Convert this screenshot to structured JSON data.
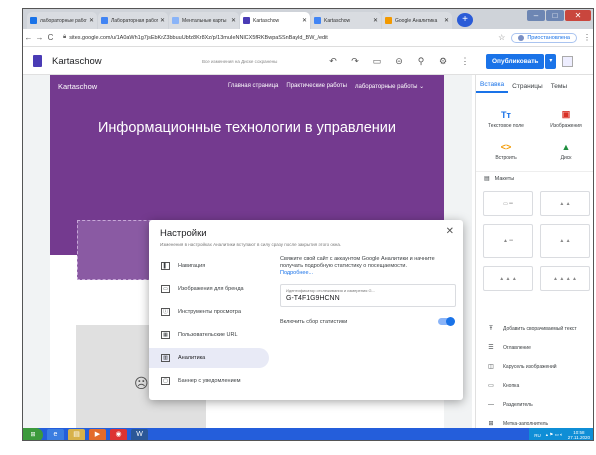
{
  "browser": {
    "tabs": [
      {
        "label": "лабораторные работ",
        "favicon_color": "#1a73e8",
        "active": false
      },
      {
        "label": "Лабораторная работ",
        "favicon_color": "#4285f4",
        "active": false
      },
      {
        "label": "Ментальные карты",
        "favicon_color": "#8ab4f8",
        "active": false
      },
      {
        "label": "Kartaschow",
        "favicon_color": "#4a3bb5",
        "active": true
      },
      {
        "label": "Kartaschow",
        "favicon_color": "#4285f4",
        "active": false
      },
      {
        "label": "Google Аналитика",
        "favicon_color": "#f29900",
        "active": false
      }
    ],
    "url": "sites.google.com/u/1A0aWh1g7jsEbKrZ3bbuuUbfz8Kr8Xz/p/13muIeNNlCX5fRKBwpaSSnBayld_BW_/edit",
    "profile_label": "Приостановлена"
  },
  "site_header": {
    "name": "Kartaschow",
    "saved_message": "Все изменения на Диске сохранены",
    "publish_label": "Опубликовать"
  },
  "site_page": {
    "name": "Kartaschow",
    "nav": [
      "Главная страница",
      "Практические работы",
      "лабораторные работы ⌄"
    ],
    "hero_title": "Информационные технологии в управлении"
  },
  "settings_dialog": {
    "title": "Настройки",
    "subtitle": "Изменения в настройках Аналитики вступают в силу сразу после закрытия этого окна.",
    "menu": [
      {
        "label": "Навигация",
        "icon": "navigation-icon",
        "active": false
      },
      {
        "label": "Изображения для бренда",
        "icon": "image-icon",
        "active": false
      },
      {
        "label": "Инструменты просмотра",
        "icon": "info-icon",
        "active": false
      },
      {
        "label": "Пользовательские URL",
        "icon": "url-icon",
        "active": false
      },
      {
        "label": "Аналитика",
        "icon": "analytics-icon",
        "active": true
      },
      {
        "label": "Баннер с уведомлением",
        "icon": "banner-icon",
        "active": false
      }
    ],
    "description": "Свяжите свой сайт с аккаунтом Google Аналитики и начните получать подробную статистику о посещаемости.",
    "more_link": "Подробнее...",
    "tracking_label": "Идентификатор отслеживания и измерения G...",
    "tracking_value": "G-T4F1G9HCNN",
    "stats_label": "Включить сбор статистики",
    "stats_enabled": true
  },
  "panel": {
    "tabs": [
      "Вставка",
      "Страницы",
      "Темы"
    ],
    "insert_items": [
      {
        "label": "Текстовое поле",
        "glyph": "Tт",
        "color": "#1a73e8"
      },
      {
        "label": "Изображения",
        "glyph": "▣",
        "color": "#d93025"
      },
      {
        "label": "Встроить",
        "glyph": "<>",
        "color": "#f29900"
      },
      {
        "label": "Диск",
        "glyph": "▲",
        "color": "#1e8e3e"
      }
    ],
    "layouts_label": "Макеты",
    "list": [
      {
        "label": "Добавить сворачиваемый текст",
        "icon": "collapsible-text-icon",
        "glyph": "Ŧ"
      },
      {
        "label": "Оглавление",
        "icon": "toc-icon",
        "glyph": "☰"
      },
      {
        "label": "Карусель изображений",
        "icon": "carousel-icon",
        "glyph": "◫"
      },
      {
        "label": "Кнопка",
        "icon": "button-icon",
        "glyph": "▭"
      },
      {
        "label": "Разделитель",
        "icon": "divider-icon",
        "glyph": "—"
      },
      {
        "label": "Метка-заполнитель",
        "icon": "placeholder-icon",
        "glyph": "⊞"
      }
    ]
  },
  "taskbar": {
    "lang": "RU",
    "time": "10:58",
    "date": "27.11.2020"
  }
}
